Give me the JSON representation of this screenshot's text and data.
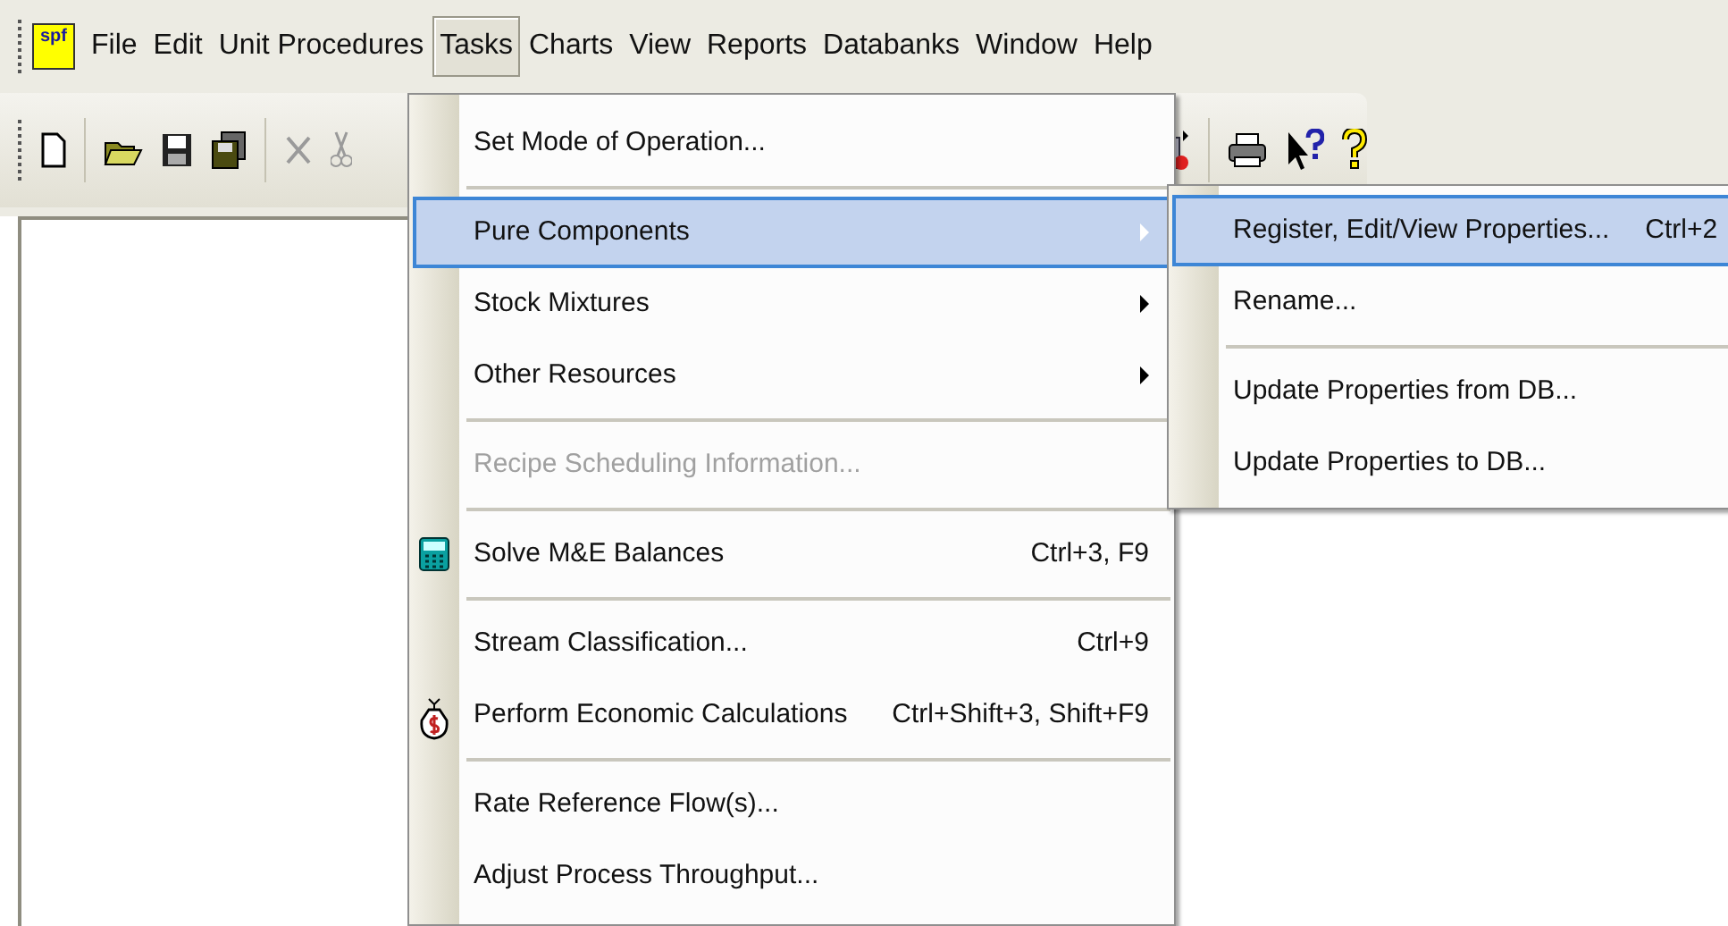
{
  "app_logo": "spf",
  "menu_bar": [
    {
      "label": "File",
      "selected": false
    },
    {
      "label": "Edit",
      "selected": false
    },
    {
      "label": "Unit Procedures",
      "selected": false
    },
    {
      "label": "Tasks",
      "selected": true
    },
    {
      "label": "Charts",
      "selected": false
    },
    {
      "label": "View",
      "selected": false
    },
    {
      "label": "Reports",
      "selected": false
    },
    {
      "label": "Databanks",
      "selected": false
    },
    {
      "label": "Window",
      "selected": false
    },
    {
      "label": "Help",
      "selected": false
    }
  ],
  "tasks_menu": [
    {
      "kind": "item",
      "label": "Set Mode of Operation...",
      "selected": false,
      "disabled": false
    },
    {
      "kind": "separator"
    },
    {
      "kind": "item",
      "label": "Pure Components",
      "submenu": true,
      "selected": true,
      "disabled": false
    },
    {
      "kind": "item",
      "label": "Stock Mixtures",
      "submenu": true,
      "selected": false,
      "disabled": false
    },
    {
      "kind": "item",
      "label": "Other Resources",
      "submenu": true,
      "selected": false,
      "disabled": false
    },
    {
      "kind": "separator"
    },
    {
      "kind": "item",
      "label": "Recipe Scheduling Information...",
      "selected": false,
      "disabled": true
    },
    {
      "kind": "separator"
    },
    {
      "kind": "item",
      "label": "Solve M&E Balances",
      "shortcut": "Ctrl+3, F9",
      "selected": false,
      "disabled": false
    },
    {
      "kind": "separator"
    },
    {
      "kind": "item",
      "label": "Stream Classification...",
      "shortcut": "Ctrl+9",
      "selected": false,
      "disabled": false
    },
    {
      "kind": "item",
      "label": "Perform Economic Calculations",
      "shortcut": "Ctrl+Shift+3, Shift+F9",
      "selected": false,
      "disabled": false
    },
    {
      "kind": "separator"
    },
    {
      "kind": "item",
      "label": "Rate Reference Flow(s)...",
      "selected": false,
      "disabled": false
    },
    {
      "kind": "item",
      "label": "Adjust Process Throughput...",
      "selected": false,
      "disabled": false
    }
  ],
  "pure_components_submenu": [
    {
      "kind": "item",
      "label": "Register, Edit/View Properties...",
      "shortcut": "Ctrl+2",
      "selected": true
    },
    {
      "kind": "item",
      "label": "Rename...",
      "selected": false
    },
    {
      "kind": "separator"
    },
    {
      "kind": "item",
      "label": "Update Properties from DB...",
      "selected": false
    },
    {
      "kind": "item",
      "label": "Update Properties to DB...",
      "selected": false
    }
  ]
}
